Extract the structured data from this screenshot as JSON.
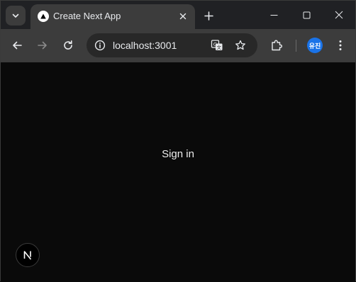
{
  "browser": {
    "tab": {
      "title": "Create Next App"
    },
    "address_bar": {
      "url": "localhost:3001"
    },
    "profile": {
      "initials": "유진",
      "color": "#1a73e8"
    }
  },
  "page": {
    "sign_in_label": "Sign in",
    "background": "#0a0a0a"
  },
  "icons": {
    "tab_search": "chevron-down-icon",
    "favicon": "next-triangle-icon",
    "close": "close-icon",
    "new_tab": "plus-icon",
    "back": "arrow-left-icon",
    "forward": "arrow-right-icon",
    "reload": "reload-icon",
    "site_info": "info-icon",
    "translate": "translate-icon",
    "bookmark": "star-icon",
    "extensions": "puzzle-icon",
    "menu": "kebab-menu-icon",
    "dev_indicator": "next-logo-icon"
  }
}
